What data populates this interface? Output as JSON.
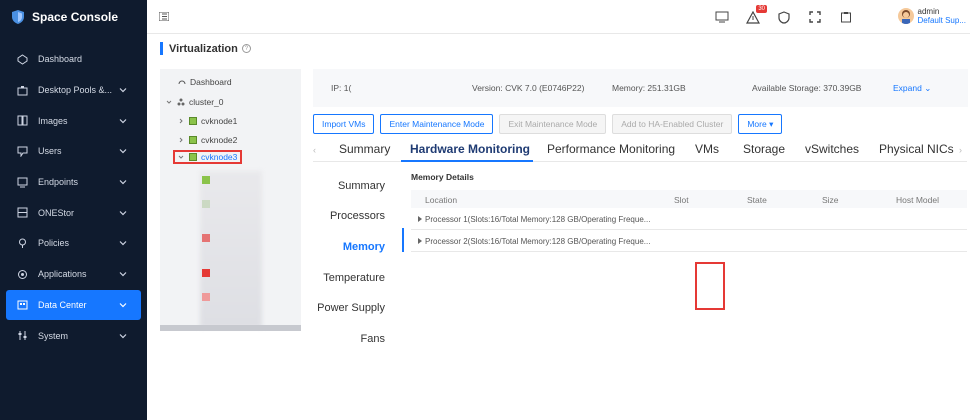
{
  "app": {
    "title": "Space Console"
  },
  "sidebar": {
    "items": [
      {
        "label": "Dashboard",
        "icon": "dashboard-icon",
        "has_children": false,
        "active": false
      },
      {
        "label": "Desktop Pools &...",
        "icon": "desktop-pools-icon",
        "has_children": true,
        "active": false
      },
      {
        "label": "Images",
        "icon": "images-icon",
        "has_children": true,
        "active": false
      },
      {
        "label": "Users",
        "icon": "users-icon",
        "has_children": true,
        "active": false
      },
      {
        "label": "Endpoints",
        "icon": "endpoints-icon",
        "has_children": true,
        "active": false
      },
      {
        "label": "ONEStor",
        "icon": "onestor-icon",
        "has_children": true,
        "active": false
      },
      {
        "label": "Policies",
        "icon": "policies-icon",
        "has_children": true,
        "active": false
      },
      {
        "label": "Applications",
        "icon": "applications-icon",
        "has_children": true,
        "active": false
      },
      {
        "label": "Data Center",
        "icon": "data-center-icon",
        "has_children": true,
        "active": true
      },
      {
        "label": "System",
        "icon": "system-icon",
        "has_children": true,
        "active": false
      }
    ]
  },
  "topbar": {
    "alert_count": "30",
    "user": {
      "name": "admin",
      "role": "Default Sup..."
    }
  },
  "page": {
    "title": "Virtualization"
  },
  "tree": {
    "dashboard": "Dashboard",
    "cluster": "cluster_0",
    "nodes": [
      "cvknode1",
      "cvknode2",
      "cvknode3"
    ]
  },
  "info": {
    "ip": "IP: 1(",
    "version": "Version: CVK 7.0 (E0746P22)",
    "memory": "Memory: 251.31GB",
    "storage": "Available Storage: 370.39GB",
    "expand": "Expand"
  },
  "actions": {
    "import_vms": "Import VMs",
    "enter_maintenance": "Enter Maintenance Mode",
    "exit_maintenance": "Exit Maintenance Mode",
    "add_ha": "Add to HA-Enabled Cluster",
    "more": "More"
  },
  "tabs": [
    "Summary",
    "Hardware Monitoring",
    "Performance Monitoring",
    "VMs",
    "Storage",
    "vSwitches",
    "Physical NICs"
  ],
  "active_tab": "Hardware Monitoring",
  "subnav": [
    "Summary",
    "Processors",
    "Memory",
    "Temperature",
    "Power Supply",
    "Fans"
  ],
  "active_subnav": "Memory",
  "memory": {
    "title": "Memory Details",
    "columns": [
      "Location",
      "Slot",
      "State",
      "Size",
      "Host Model"
    ],
    "rows": [
      "Processor 1(Slots:16/Total Memory:128 GB/Operating Freque...",
      "Processor 2(Slots:16/Total Memory:128 GB/Operating Freque..."
    ]
  },
  "colors": {
    "accent": "#1677ff",
    "sidebar_bg": "#0f1b2e",
    "highlight": "#e53935"
  }
}
